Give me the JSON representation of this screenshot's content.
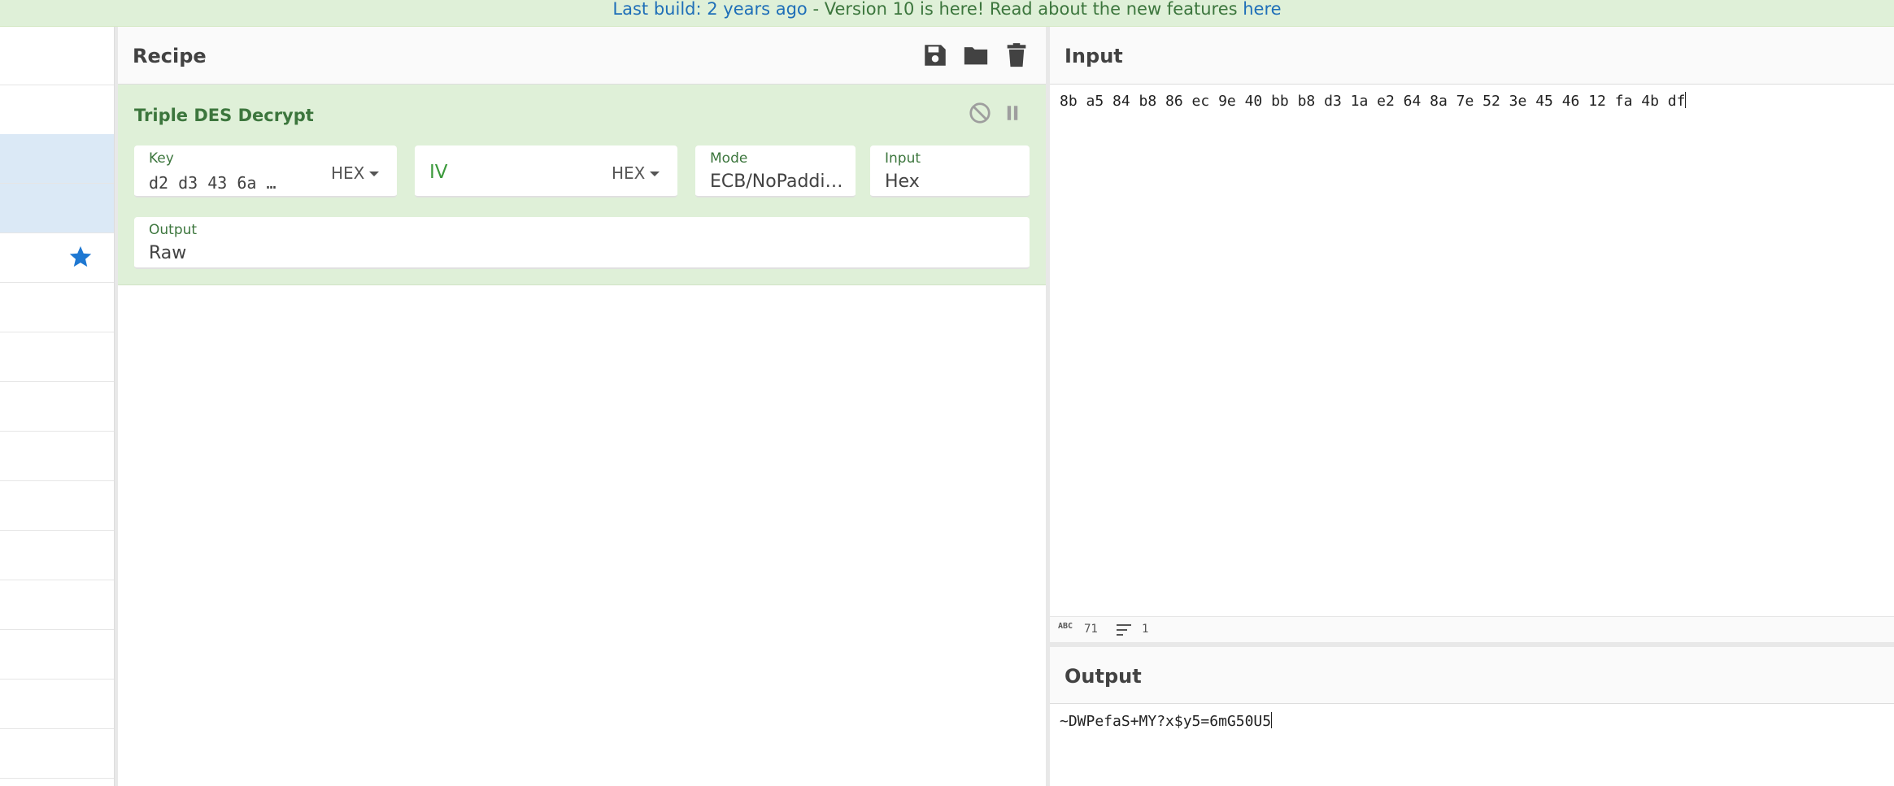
{
  "banner": {
    "link1": "Last build: 2 years ago",
    "middle": " - Version 10 is here! Read about the new features ",
    "link2": "here"
  },
  "recipe": {
    "title": "Recipe",
    "icons": [
      "save-icon",
      "folder-icon",
      "trash-icon"
    ],
    "operation": {
      "name": "Triple DES Decrypt",
      "key": {
        "label": "Key",
        "value": "d2 d3 43 6a …",
        "format": "HEX"
      },
      "iv": {
        "placeholder": "IV",
        "format": "HEX"
      },
      "mode": {
        "label": "Mode",
        "value": "ECB/NoPaddi…"
      },
      "input": {
        "label": "Input",
        "value": "Hex"
      },
      "output": {
        "label": "Output",
        "value": "Raw"
      }
    }
  },
  "input": {
    "title": "Input",
    "text": "8b a5 84 b8 86 ec 9e 40 bb b8 d3 1a e2 64 8a 7e 52 3e 45 46 12 fa 4b df",
    "status": {
      "length_icon": "ABC",
      "length": "71",
      "lines": "1"
    }
  },
  "output": {
    "title": "Output",
    "text": "~DWPefaS+MY?x$y5=6mG50U5"
  },
  "colors": {
    "banner_bg": "#dff0d8",
    "banner_text": "#3c763d",
    "link": "#1f6fb8",
    "operation_bg": "#dff0d8",
    "selected_row": "#dbe9f6",
    "star": "#1e78d2"
  }
}
